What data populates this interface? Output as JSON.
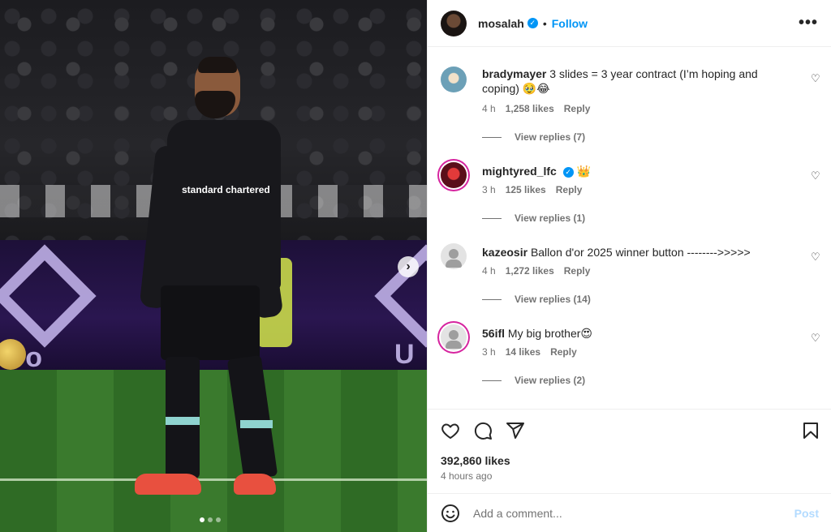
{
  "post": {
    "author": "mosalah",
    "follow_label": "Follow",
    "separator": "•",
    "more_label": "•••",
    "next_label": "›",
    "likes": "392,860 likes",
    "time_ago": "4 hours ago",
    "media_carousel": {
      "slides": 3,
      "active_index": 0
    },
    "media_text": {
      "sponsor": "standard chartered",
      "board_left": "ro",
      "board_right": "U"
    }
  },
  "comments": [
    {
      "user": "bradymayer",
      "text": "3 slides = 3 year contract (I’m hoping and coping) 🥹😂",
      "time": "4 h",
      "likes": "1,258 likes",
      "reply": "Reply",
      "view_replies": "View replies (7)"
    },
    {
      "user": "mightyred_lfc",
      "text": "👑",
      "verified": true,
      "time": "3 h",
      "likes": "125 likes",
      "reply": "Reply",
      "view_replies": "View replies (1)"
    },
    {
      "user": "kazeosir",
      "text": "Ballon d'or 2025 winner button -------->>>>>",
      "time": "4 h",
      "likes": "1,272 likes",
      "reply": "Reply",
      "view_replies": "View replies (14)"
    },
    {
      "user": "56ifl",
      "text": "My big brother😍",
      "time": "3 h",
      "likes": "14 likes",
      "reply": "Reply",
      "view_replies": "View replies (2)"
    }
  ],
  "composer": {
    "placeholder": "Add a comment...",
    "post_label": "Post"
  },
  "icons": {
    "verified": "verified-badge-icon",
    "heart": "heart-icon",
    "comment": "comment-icon",
    "share": "share-icon",
    "save": "bookmark-icon",
    "emoji": "emoji-icon",
    "next": "chevron-right-icon"
  },
  "colors": {
    "accent": "#0095f6",
    "muted": "#737373",
    "post_disabled": "#b3dbff"
  }
}
